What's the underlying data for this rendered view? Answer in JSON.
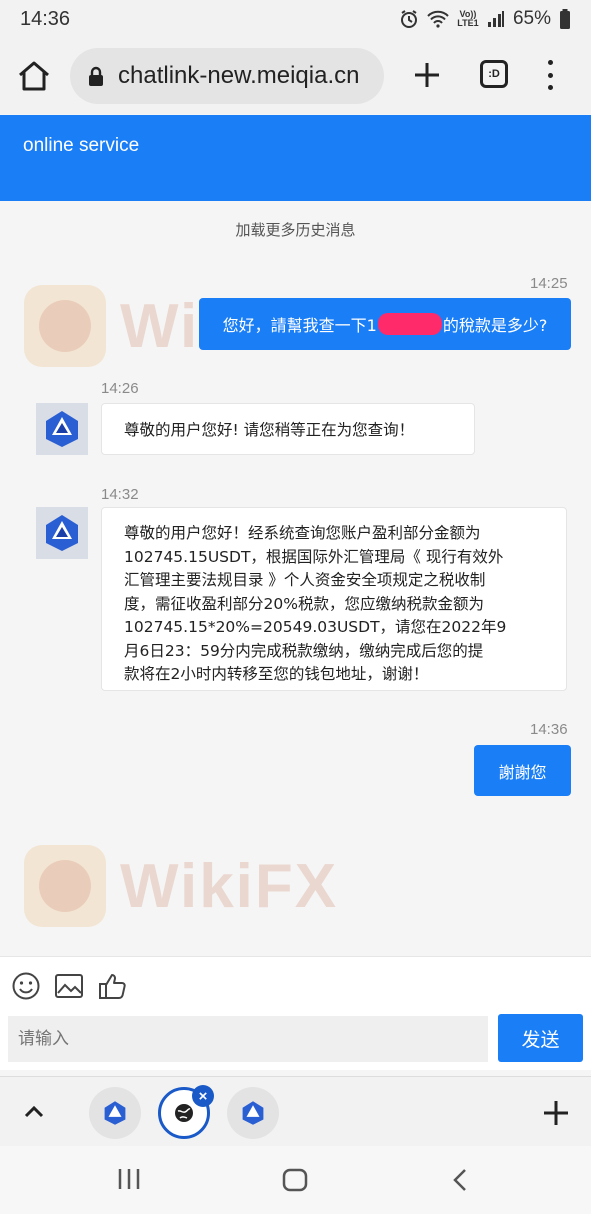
{
  "status_bar": {
    "time": "14:36",
    "network_label": "Vo)) LTE1",
    "battery": "65%",
    "icons": [
      "alarm-icon",
      "wifi-icon",
      "signal-icon",
      "battery-icon"
    ]
  },
  "browser": {
    "url": "chatlink-new.meiqia.cn",
    "tab_badge": ":D"
  },
  "chat": {
    "header_title": "online service",
    "load_more": "加载更多历史消息",
    "messages": [
      {
        "time": "14:25",
        "direction": "out",
        "text_before": "您好，請幫我查一下1",
        "text_after": "的稅款是多少?"
      },
      {
        "time": "14:26",
        "direction": "in",
        "text": "尊敬的用户您好! 请您稍等正在为您查询！"
      },
      {
        "time": "14:32",
        "direction": "in",
        "lines": [
          "尊敬的用户您好！经系统查询您账户盈利部分金额为",
          "102745.15USDT，根据国际外汇管理局《 现行有效外",
          "汇管理主要法规目录 》个人资金安全项规定之税收制",
          "度，需征收盈利部分20%税款，您应缴纳税款金额为",
          "102745.15*20%=20549.03USDT，请您在2022年9",
          "月6日23：59分内完成税款缴纳，缴纳完成后您的提",
          "款将在2小时内转移至您的钱包地址，谢谢！"
        ]
      },
      {
        "time": "14:36",
        "direction": "out",
        "text": "謝謝您"
      }
    ],
    "watermark": "WikiFX"
  },
  "composer": {
    "placeholder": "请输入",
    "send_label": "发送",
    "tools": [
      "emoji-icon",
      "image-icon",
      "thumbs-up-icon"
    ]
  },
  "colors": {
    "accent": "#1a7ef7",
    "redaction": "#ff2a6a"
  }
}
